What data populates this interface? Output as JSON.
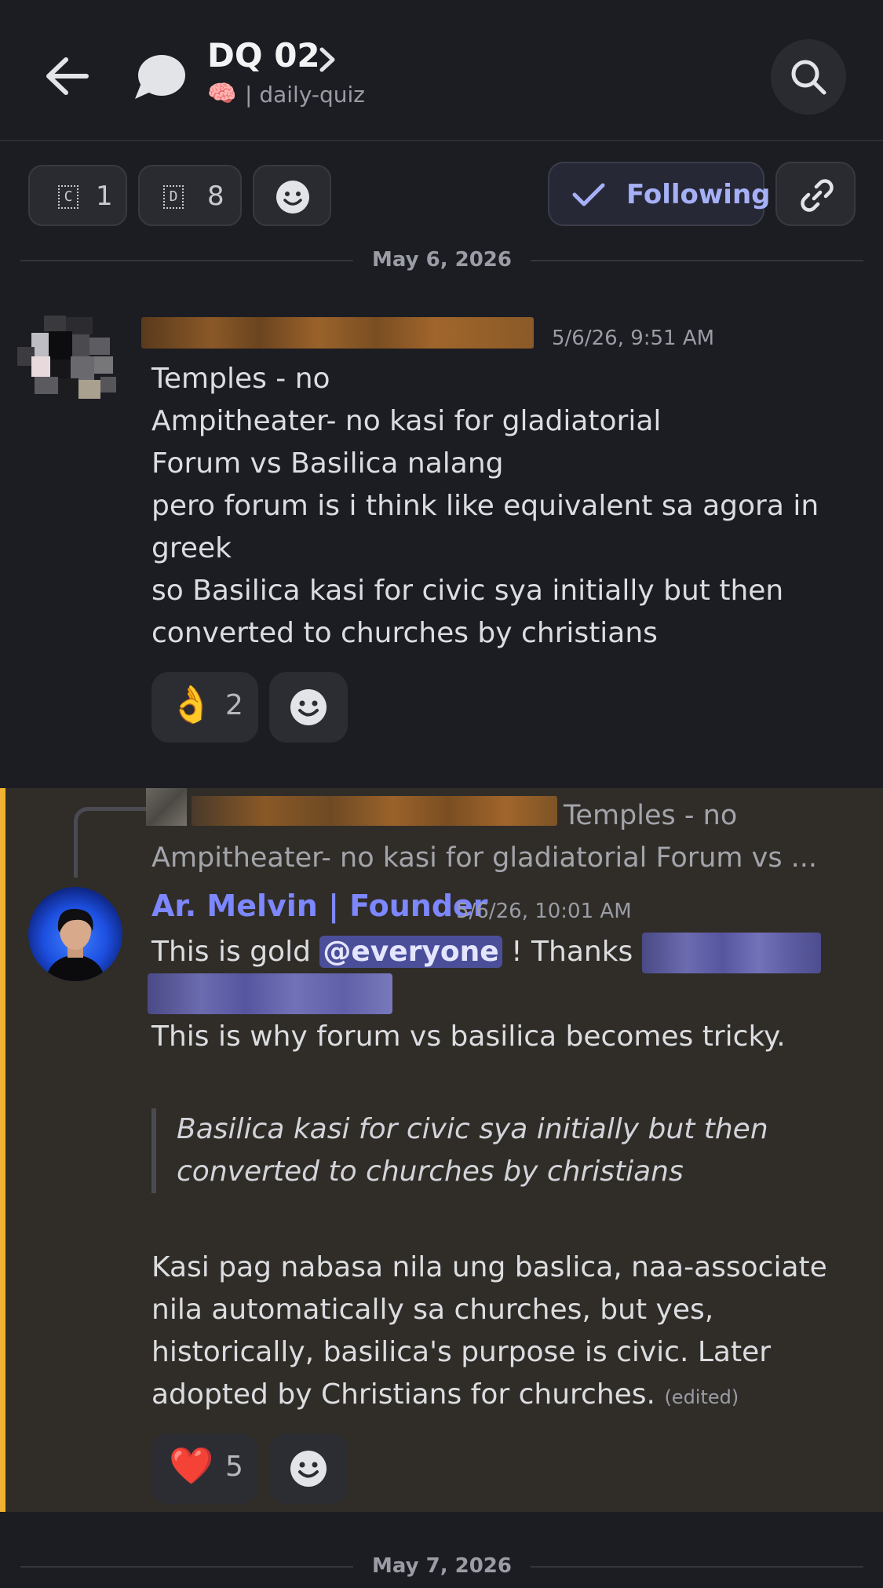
{
  "header": {
    "thread_title": "DQ 02",
    "channel_emoji": "🧠",
    "channel_name": "| daily-quiz",
    "icons": [
      "back-arrow-icon",
      "thread-icon",
      "chevron-right-icon",
      "search-icon"
    ]
  },
  "toolbar": {
    "pill_c_glyph": "C",
    "pill_c_count": "1",
    "pill_d_glyph": "D",
    "pill_d_count": "8",
    "following_label": "Following",
    "icons": [
      "smiley-icon",
      "checkmark-icon",
      "link-icon"
    ]
  },
  "dividers": {
    "first": "May 6, 2026",
    "second": "May 7, 2026"
  },
  "messages": [
    {
      "timestamp": "5/6/26, 9:51 AM",
      "lines": "Temples - no\nAmpitheater-  no kasi for gladiatorial\nForum vs Basilica nalang\npero forum is i think like equivalent sa agora in\ngreek\nso Basilica kasi for civic sya initially but then\nconverted to churches by christians",
      "reaction_emoji": "👌",
      "reaction_count": "2"
    },
    {
      "reply_line1": "Temples - no",
      "reply_line2": "Ampitheater-  no kasi for gladiatorial Forum vs ...",
      "author": "Ar. Melvin | Founder",
      "timestamp": "5/6/26, 10:01 AM",
      "text_before_mention": "This is gold ",
      "mention": "@everyone",
      "text_after_mention": " ! Thanks ",
      "line_tricky": "This is why forum vs basilica becomes tricky.",
      "quote": "Basilica kasi for civic sya initially but then\nconverted to churches by christians",
      "body": "Kasi pag nabasa nila ung baslica, naa-associate\nnila automatically sa churches, but yes,\nhistorically, basilica's purpose is civic. Later\nadopted by Christians for churches. ",
      "edited": "(edited)",
      "reaction_emoji": "❤️",
      "reaction_count": "5"
    }
  ],
  "colors": {
    "background": "#1c1d22",
    "highlight": "#302d28",
    "highlight_bar": "#f0b232",
    "author_name": "#7d87ff",
    "mention_bg": "#4b4f9a",
    "following_text": "#a6b0f7"
  }
}
